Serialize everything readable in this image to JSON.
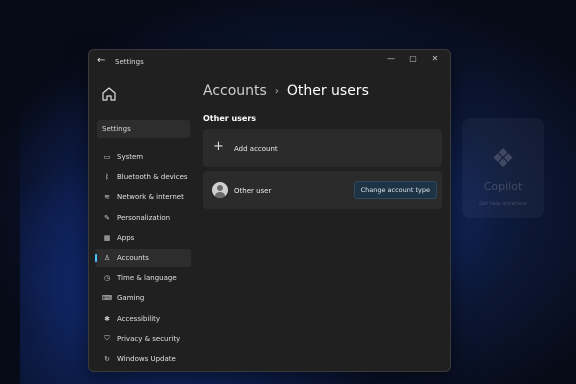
{
  "window": {
    "title": "Settings"
  },
  "search": {
    "value": "Settings"
  },
  "breadcrumb": {
    "parent": "Accounts",
    "separator": "›",
    "current": "Other users"
  },
  "section": {
    "title": "Other users"
  },
  "cards": {
    "add_account": {
      "label": "Add account"
    },
    "other_user": {
      "label": "Other user",
      "button": "Change account type"
    }
  },
  "sidebar": {
    "items": [
      {
        "label": "System",
        "icon": "monitor-icon",
        "glyph": "▭"
      },
      {
        "label": "Bluetooth & devices",
        "icon": "bluetooth-icon",
        "glyph": "ᛒ"
      },
      {
        "label": "Network & internet",
        "icon": "wifi-icon",
        "glyph": "≋"
      },
      {
        "label": "Personalization",
        "icon": "brush-icon",
        "glyph": "✎"
      },
      {
        "label": "Apps",
        "icon": "apps-icon",
        "glyph": "▦"
      },
      {
        "label": "Accounts",
        "icon": "person-icon",
        "glyph": "♙",
        "active": true
      },
      {
        "label": "Time & language",
        "icon": "clock-icon",
        "glyph": "◷"
      },
      {
        "label": "Gaming",
        "icon": "gamepad-icon",
        "glyph": "⌨"
      },
      {
        "label": "Accessibility",
        "icon": "accessibility-icon",
        "glyph": "✱"
      },
      {
        "label": "Privacy & security",
        "icon": "shield-icon",
        "glyph": "⛉"
      },
      {
        "label": "Windows Update",
        "icon": "update-icon",
        "glyph": "↻"
      }
    ]
  },
  "background": {
    "copilot": {
      "name": "Copilot",
      "subtitle": "Get help anywhere"
    }
  },
  "colors": {
    "accent": "#4cc2ff",
    "window_bg": "#202020",
    "card_bg": "#2b2b2b"
  }
}
